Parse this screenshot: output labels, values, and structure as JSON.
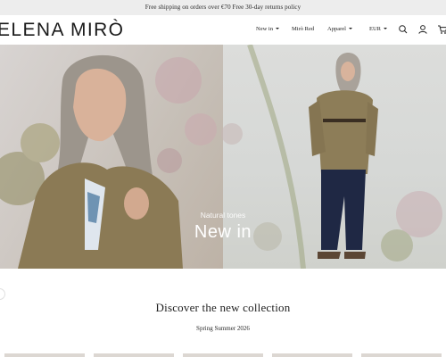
{
  "announcement": "Free shipping on orders over €70 Free 30-day returns policy",
  "brand": {
    "name": "ELENA MIRÒ"
  },
  "nav": {
    "items": [
      {
        "label": "New in",
        "has_dropdown": true
      },
      {
        "label": "Mirò Red",
        "has_dropdown": false
      },
      {
        "label": "Apparel",
        "has_dropdown": true
      }
    ],
    "currency": "EUR"
  },
  "header_icons": [
    "search-icon",
    "account-icon",
    "cart-icon"
  ],
  "hero": {
    "subtitle": "Natural tones",
    "title": "New in"
  },
  "collection": {
    "title": "Discover the new collection",
    "subtitle": "Spring Summer 2026"
  },
  "colors": {
    "announcement_bg": "#ededed",
    "text": "#1e1e1e",
    "hero_text": "#ffffff"
  }
}
